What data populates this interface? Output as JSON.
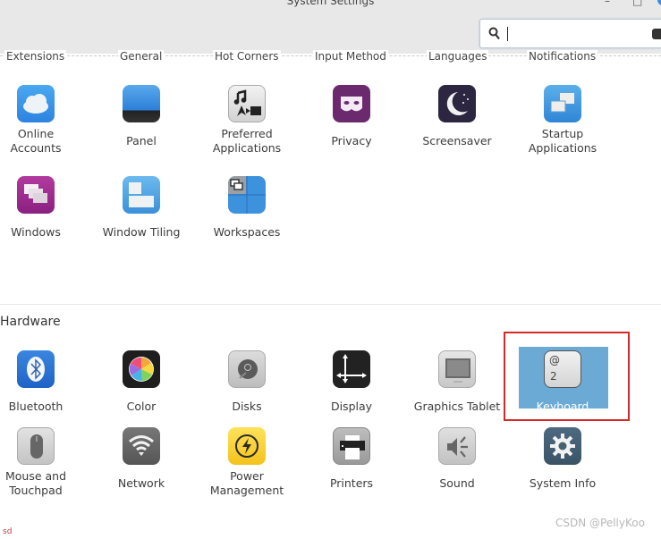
{
  "window": {
    "title": "System Settings",
    "minimize": "–",
    "maximize": "□"
  },
  "search": {
    "value": "",
    "placeholder": "",
    "icon": "search-icon",
    "clear_icon": "clear-icon"
  },
  "top_tabs": [
    "Extensions",
    "General",
    "Hot Corners",
    "Input Method",
    "Languages",
    "Notifications"
  ],
  "preferences_items": [
    {
      "label": "Online Accounts",
      "icon": "cloud-icon"
    },
    {
      "label": "Panel",
      "icon": "panel-icon"
    },
    {
      "label": "Preferred Applications",
      "icon": "preferred-applications-icon"
    },
    {
      "label": "Privacy",
      "icon": "mask-icon"
    },
    {
      "label": "Screensaver",
      "icon": "moon-icon"
    },
    {
      "label": "Startup Applications",
      "icon": "startup-icon"
    },
    {
      "label": "Windows",
      "icon": "windows-icon"
    },
    {
      "label": "Window Tiling",
      "icon": "window-tiling-icon"
    },
    {
      "label": "Workspaces",
      "icon": "workspaces-icon"
    }
  ],
  "hardware": {
    "title": "Hardware",
    "items": [
      {
        "label": "Bluetooth",
        "icon": "bluetooth-icon"
      },
      {
        "label": "Color",
        "icon": "color-icon"
      },
      {
        "label": "Disks",
        "icon": "disk-icon"
      },
      {
        "label": "Display",
        "icon": "display-icon"
      },
      {
        "label": "Graphics Tablet",
        "icon": "tablet-icon"
      },
      {
        "label": "Keyboard",
        "icon": "keyboard-icon",
        "selected": true,
        "key_top": "@",
        "key_bottom": "2"
      },
      {
        "label": "Mouse and Touchpad",
        "icon": "mouse-icon"
      },
      {
        "label": "Network",
        "icon": "wifi-icon"
      },
      {
        "label": "Power Management",
        "icon": "power-icon"
      },
      {
        "label": "Printers",
        "icon": "printer-icon"
      },
      {
        "label": "Sound",
        "icon": "speaker-icon"
      },
      {
        "label": "System Info",
        "icon": "gear-icon"
      }
    ]
  },
  "colors": {
    "selection": "#6aaad4",
    "highlight_border": "#d42a2a"
  },
  "footer": {
    "mark": "sd",
    "watermark": "CSDN @PellyKoo"
  }
}
